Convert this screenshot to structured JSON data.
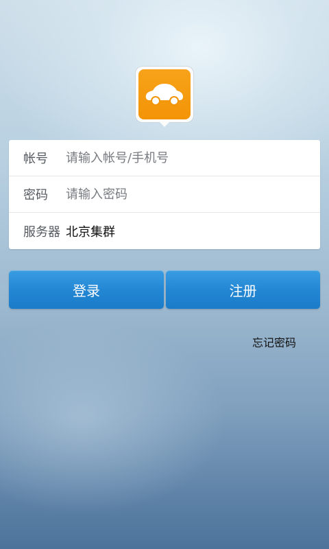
{
  "app": {
    "logo_icon": "car-icon",
    "logo_color": "#f39c0c"
  },
  "form": {
    "account": {
      "label": "帐号",
      "placeholder": "请输入帐号/手机号",
      "value": ""
    },
    "password": {
      "label": "密码",
      "placeholder": "请输入密码",
      "value": ""
    },
    "server": {
      "label": "服务器",
      "value": "北京集群"
    }
  },
  "actions": {
    "login_label": "登录",
    "register_label": "注册",
    "forgot_label": "忘记密码"
  },
  "colors": {
    "accent": "#2387d4"
  }
}
